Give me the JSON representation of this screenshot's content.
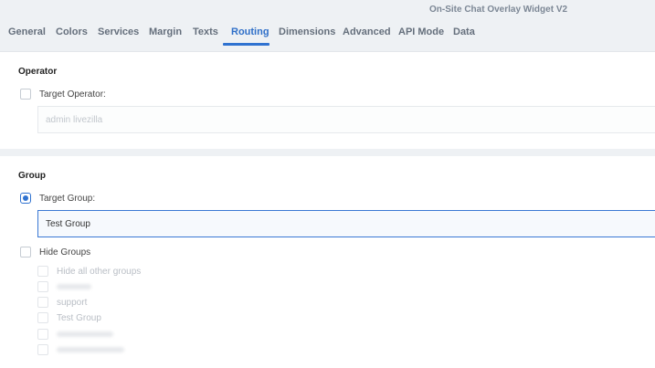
{
  "window": {
    "title": "On-Site Chat Overlay Widget V2"
  },
  "tabs": [
    {
      "label": "General"
    },
    {
      "label": "Colors"
    },
    {
      "label": "Services"
    },
    {
      "label": "Margin"
    },
    {
      "label": "Texts"
    },
    {
      "label": "Routing"
    },
    {
      "label": "Dimensions"
    },
    {
      "label": "Advanced"
    },
    {
      "label": "API Mode"
    },
    {
      "label": "Data"
    }
  ],
  "active_tab": "Routing",
  "colors": {
    "accent": "#2f72d0",
    "background": "#eef1f4"
  },
  "operator": {
    "title": "Operator",
    "target_label": "Target Operator:",
    "target_checked": false,
    "value": "admin livezilla"
  },
  "group": {
    "title": "Group",
    "target_label": "Target Group:",
    "target_checked": true,
    "value": "Test Group",
    "hide_label": "Hide Groups",
    "hide_checked": false,
    "options": [
      {
        "label": "Hide all other groups"
      },
      {
        "label": ""
      },
      {
        "label": "support"
      },
      {
        "label": "Test Group"
      },
      {
        "label": ""
      },
      {
        "label": ""
      }
    ]
  }
}
